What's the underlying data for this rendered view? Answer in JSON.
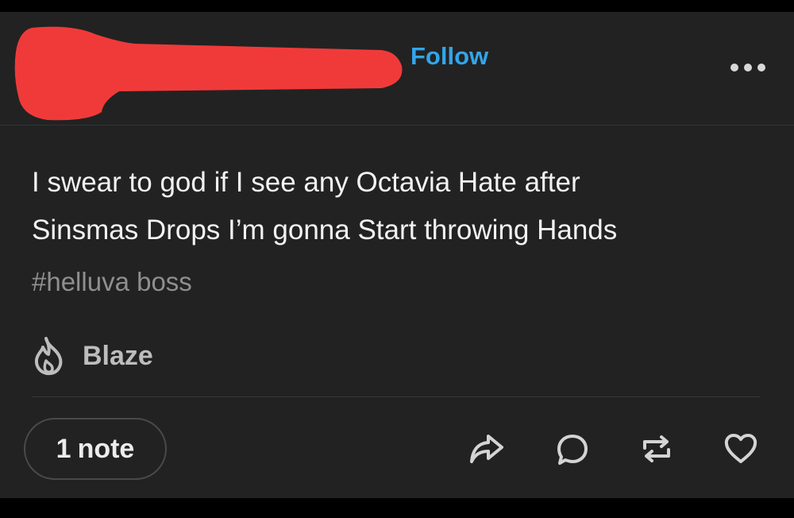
{
  "post": {
    "author_redacted": true,
    "follow_label": "Follow",
    "more_icon": "more-horizontal-icon",
    "body_lines": [
      "I swear to god if I see any Octavia Hate after",
      "Sinsmas Drops I’m gonna Start throwing Hands"
    ],
    "tag": "#helluva boss",
    "blaze_label": "Blaze",
    "notes": {
      "count": "1",
      "label": "note"
    },
    "actions": [
      {
        "name": "share",
        "icon": "share-arrow-icon"
      },
      {
        "name": "reply",
        "icon": "reply-bubble-icon"
      },
      {
        "name": "reblog",
        "icon": "reblog-icon"
      },
      {
        "name": "like",
        "icon": "heart-icon"
      }
    ],
    "colors": {
      "background": "#222222",
      "follow": "#33a5e8",
      "redaction": "#f03a3a",
      "tag": "#8f8f8f",
      "icon": "#d4d4d4"
    }
  }
}
